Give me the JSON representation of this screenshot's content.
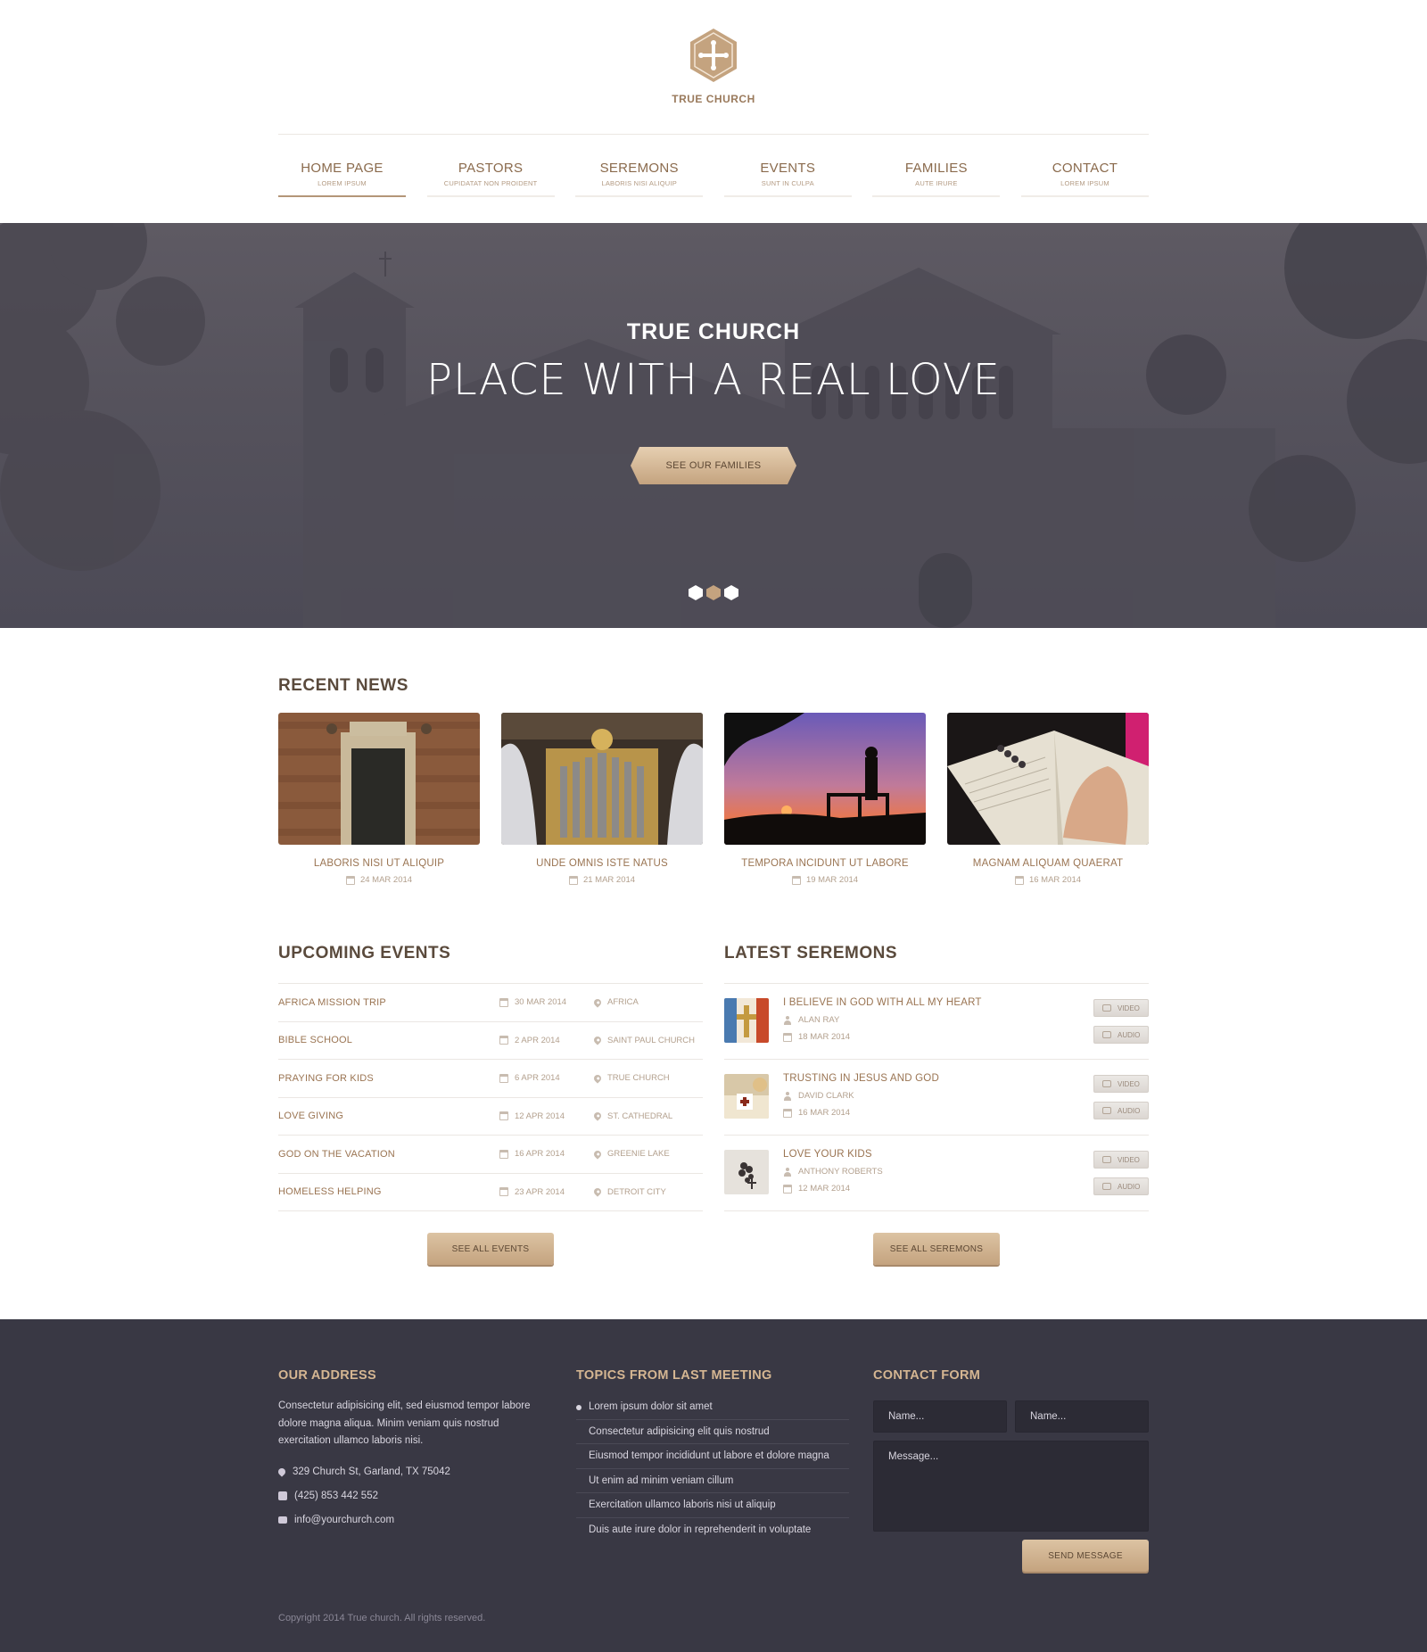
{
  "brand": {
    "name": "TRUE CHURCH"
  },
  "nav": [
    {
      "label": "HOME PAGE",
      "sub": "LOREM IPSUM",
      "active": true
    },
    {
      "label": "PASTORS",
      "sub": "CUPIDATAT NON PROIDENT"
    },
    {
      "label": "SEREMONS",
      "sub": "LABORIS NISI ALIQUIP"
    },
    {
      "label": "EVENTS",
      "sub": "SUNT IN CULPA"
    },
    {
      "label": "FAMILIES",
      "sub": "AUTE IRURE"
    },
    {
      "label": "CONTACT",
      "sub": "LOREM IPSUM"
    }
  ],
  "hero": {
    "kicker": "TRUE CHURCH",
    "title": "PLACE WITH A REAL LOVE",
    "button": "SEE OUR FAMILIES",
    "slides": 3,
    "active_slide": 2
  },
  "news": {
    "title": "RECENT NEWS",
    "items": [
      {
        "title": "LABORIS NISI UT ALIQUIP",
        "date": "24 MAR 2014"
      },
      {
        "title": "UNDE OMNIS ISTE NATUS",
        "date": "21 MAR 2014"
      },
      {
        "title": "TEMPORA INCIDUNT UT LABORE",
        "date": "19 MAR 2014"
      },
      {
        "title": "MAGNAM ALIQUAM QUAERAT",
        "date": "16 MAR 2014"
      }
    ]
  },
  "events": {
    "title": "UPCOMING EVENTS",
    "button": "SEE ALL EVENTS",
    "items": [
      {
        "name": "AFRICA MISSION TRIP",
        "date": "30 MAR 2014",
        "location": "AFRICA"
      },
      {
        "name": "BIBLE SCHOOL",
        "date": "2 APR 2014",
        "location": "SAINT PAUL CHURCH"
      },
      {
        "name": "PRAYING FOR KIDS",
        "date": "6 APR 2014",
        "location": "TRUE CHURCH"
      },
      {
        "name": "LOVE GIVING",
        "date": "12 APR 2014",
        "location": "ST. CATHEDRAL"
      },
      {
        "name": "GOD ON THE VACATION",
        "date": "16 APR 2014",
        "location": "GREENIE LAKE"
      },
      {
        "name": "HOMELESS HELPING",
        "date": "23 APR 2014",
        "location": "DETROIT CITY"
      }
    ]
  },
  "sermons": {
    "title": "LATEST SEREMONS",
    "button": "SEE ALL SEREMONS",
    "video_label": "VIDEO",
    "audio_label": "AUDIO",
    "items": [
      {
        "title": "I BELIEVE IN GOD WITH ALL MY HEART",
        "author": "ALAN RAY",
        "date": "18 MAR 2014"
      },
      {
        "title": "TRUSTING IN JESUS AND GOD",
        "author": "DAVID CLARK",
        "date": "16 MAR 2014"
      },
      {
        "title": "LOVE YOUR KIDS",
        "author": "ANTHONY ROBERTS",
        "date": "12 MAR 2014"
      }
    ]
  },
  "footer": {
    "address": {
      "title": "OUR ADDRESS",
      "text": "Consectetur adipisicing elit, sed eiusmod tempor labore dolore magna aliqua. Minim veniam quis nostrud exercitation ullamco laboris nisi.",
      "street": "329 Church St, Garland, TX 75042",
      "phone": "(425) 853 442 552",
      "email": "info@yourchurch.com"
    },
    "topics": {
      "title": "TOPICS FROM LAST MEETING",
      "items": [
        "Lorem ipsum dolor sit amet",
        "Consectetur adipisicing elit quis nostrud",
        "Eiusmod tempor incididunt ut labore et dolore magna",
        "Ut enim ad minim veniam cillum",
        "Exercitation ullamco laboris nisi ut aliquip",
        "Duis aute irure dolor in reprehenderit in voluptate"
      ]
    },
    "contact": {
      "title": "CONTACT FORM",
      "name_placeholder": "Name...",
      "name2_placeholder": "Name...",
      "message_placeholder": "Message...",
      "button": "SEND MESSAGE"
    },
    "copyright": "Copyright 2014 True church. All rights reserved."
  },
  "colors": {
    "accent": "#c4a37f",
    "brown_text": "#9a7452",
    "footer_bg": "#393844",
    "hero_overlay": "#55525c"
  }
}
